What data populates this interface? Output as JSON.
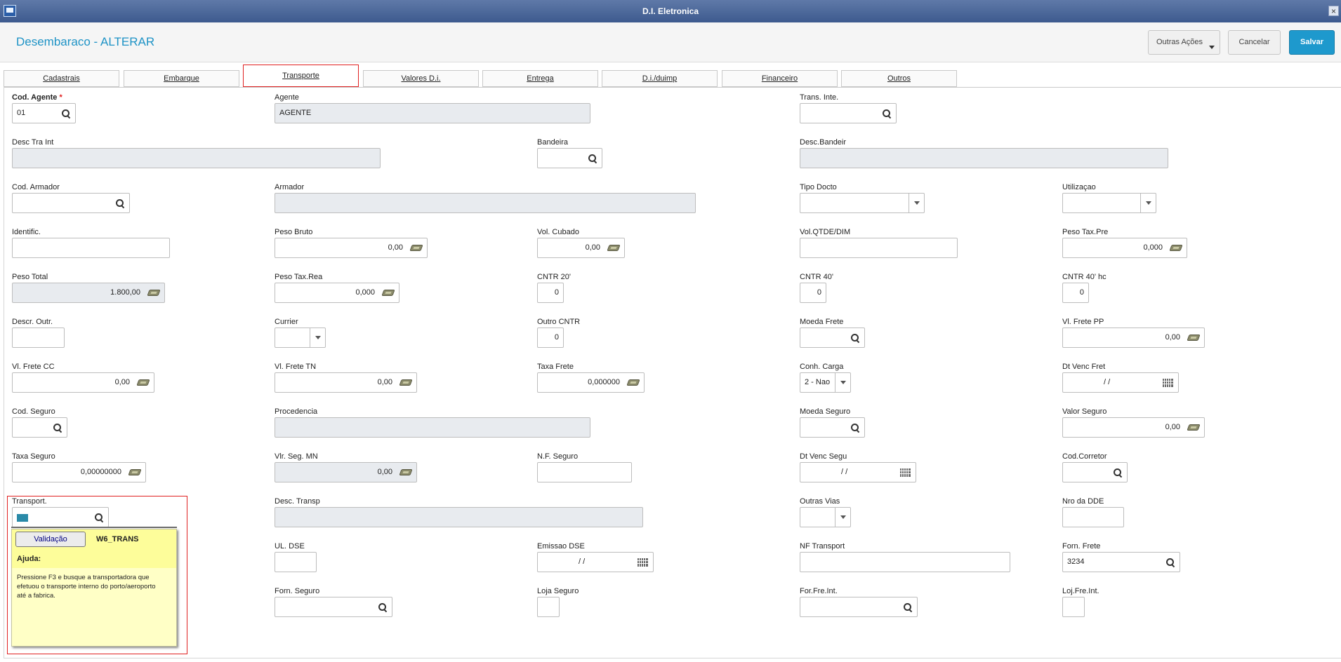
{
  "window": {
    "title": "D.I. Eletronica",
    "close": "×"
  },
  "header": {
    "title": "Desembaraco - ALTERAR",
    "outras_acoes": "Outras Ações",
    "cancelar": "Cancelar",
    "salvar": "Salvar"
  },
  "tabs": [
    "Cadastrais",
    "Embarque",
    "Transporte",
    "Valores D.i.",
    "Entrega",
    "D.i./duimp",
    "Financeiro",
    "Outros"
  ],
  "active_tab": "Transporte",
  "fields": {
    "cod_agente": {
      "label": "Cod. Agente",
      "required": "*",
      "value": "01"
    },
    "agente": {
      "label": "Agente",
      "value": "AGENTE"
    },
    "trans_inte": {
      "label": "Trans. Inte.",
      "value": ""
    },
    "desc_tra_int": {
      "label": "Desc Tra Int",
      "value": ""
    },
    "bandeira": {
      "label": "Bandeira",
      "value": ""
    },
    "desc_bandeir": {
      "label": "Desc.Bandeir",
      "value": ""
    },
    "cod_armador": {
      "label": "Cod. Armador",
      "value": ""
    },
    "armador": {
      "label": "Armador",
      "value": ""
    },
    "tipo_docto": {
      "label": "Tipo Docto",
      "value": ""
    },
    "utilizacao": {
      "label": "Utilizaçao",
      "value": ""
    },
    "identific": {
      "label": "Identific.",
      "value": ""
    },
    "peso_bruto": {
      "label": "Peso Bruto",
      "value": "0,00"
    },
    "vol_cubado": {
      "label": "Vol. Cubado",
      "value": "0,00"
    },
    "vol_qtde_dim": {
      "label": "Vol.QTDE/DIM",
      "value": ""
    },
    "peso_tax_pre": {
      "label": "Peso Tax.Pre",
      "value": "0,000"
    },
    "peso_total": {
      "label": "Peso Total",
      "value": "1.800,00"
    },
    "peso_tax_rea": {
      "label": "Peso Tax.Rea",
      "value": "0,000"
    },
    "cntr_20": {
      "label": "CNTR 20'",
      "value": "0"
    },
    "cntr_40": {
      "label": "CNTR 40'",
      "value": "0"
    },
    "cntr_40_hc": {
      "label": "CNTR 40' hc",
      "value": "0"
    },
    "descr_outr": {
      "label": "Descr. Outr.",
      "value": ""
    },
    "currier": {
      "label": "Currier",
      "value": ""
    },
    "outro_cntr": {
      "label": "Outro CNTR",
      "value": "0"
    },
    "moeda_frete": {
      "label": "Moeda Frete",
      "value": ""
    },
    "vl_frete_pp": {
      "label": "Vl. Frete PP",
      "value": "0,00"
    },
    "vl_frete_cc": {
      "label": "Vl. Frete CC",
      "value": "0,00"
    },
    "vl_frete_tn": {
      "label": "Vl. Frete TN",
      "value": "0,00"
    },
    "taxa_frete": {
      "label": "Taxa Frete",
      "value": "0,000000"
    },
    "conh_carga": {
      "label": "Conh. Carga",
      "value": "2 - Nao"
    },
    "dt_venc_fret": {
      "label": "Dt Venc Fret",
      "value": "/ /"
    },
    "cod_seguro": {
      "label": "Cod. Seguro",
      "value": ""
    },
    "procedencia": {
      "label": "Procedencia",
      "value": ""
    },
    "moeda_seguro": {
      "label": "Moeda Seguro",
      "value": ""
    },
    "valor_seguro": {
      "label": "Valor Seguro",
      "value": "0,00"
    },
    "taxa_seguro": {
      "label": "Taxa Seguro",
      "value": "0,00000000"
    },
    "vlr_seg_mn": {
      "label": "Vlr. Seg. MN",
      "value": "0,00"
    },
    "nf_seguro": {
      "label": "N.F. Seguro",
      "value": ""
    },
    "dt_venc_segu": {
      "label": "Dt Venc Segu",
      "value": "/ /"
    },
    "cod_corretor": {
      "label": "Cod.Corretor",
      "value": ""
    },
    "transport": {
      "label": "Transport.",
      "value": ""
    },
    "desc_transp": {
      "label": "Desc. Transp",
      "value": ""
    },
    "outras_vias": {
      "label": "Outras Vias",
      "value": ""
    },
    "nro_dde": {
      "label": "Nro da DDE",
      "value": ""
    },
    "ul_dse": {
      "label": "UL. DSE",
      "value": ""
    },
    "emissao_dse": {
      "label": "Emissao DSE",
      "value": "/ /"
    },
    "nf_transport": {
      "label": "NF Transport",
      "value": ""
    },
    "forn_frete": {
      "label": "Forn. Frete",
      "value": "3234"
    },
    "forn_seguro": {
      "label": "Forn. Seguro",
      "value": ""
    },
    "loja_seguro": {
      "label": "Loja Seguro",
      "value": ""
    },
    "for_fre_int": {
      "label": "For.Fre.Int.",
      "value": ""
    },
    "loj_fre_int": {
      "label": "Loj.Fre.Int.",
      "value": ""
    }
  },
  "help": {
    "button": "Validação",
    "code": "W6_TRANS",
    "heading": "Ajuda:",
    "text": "Pressione F3 e busque a transportadora que efetuou o transporte interno do porto/aeroporto até a fabrica."
  },
  "colors": {
    "accent": "#1e99cd",
    "title": "#1e93c6",
    "highlight_border": "#e02020",
    "help_bg": "#ffffc6"
  }
}
